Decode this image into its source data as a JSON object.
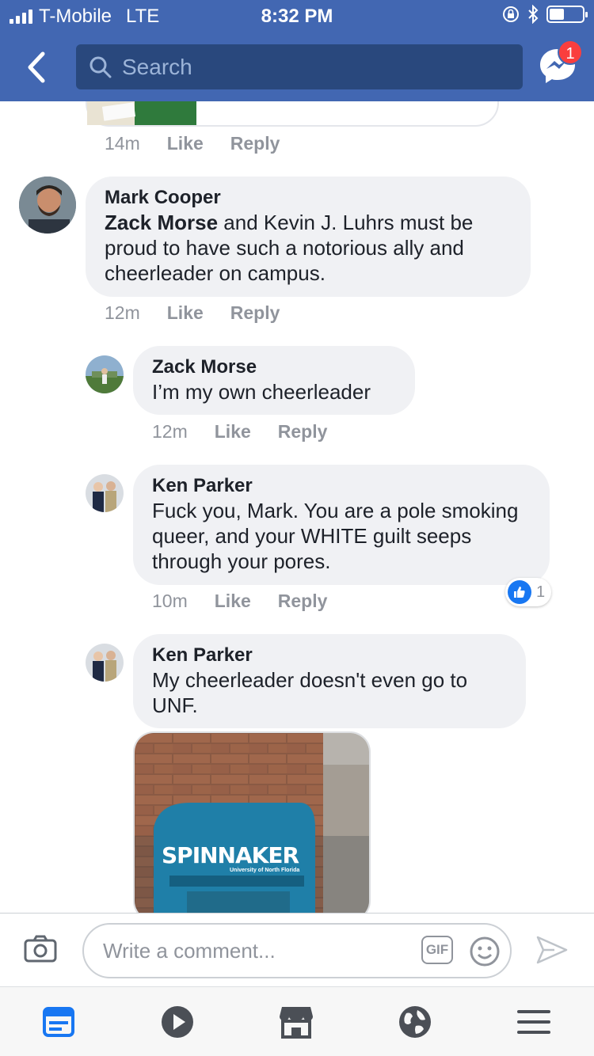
{
  "status_bar": {
    "carrier": "T-Mobile",
    "network": "LTE",
    "time": "8:32 PM"
  },
  "header": {
    "search_placeholder": "Search",
    "messenger_badge": "1"
  },
  "comments": [
    {
      "time": "14m",
      "like": "Like",
      "reply": "Reply"
    },
    {
      "name": "Mark Cooper",
      "mention": "Zack Morse",
      "text_after_mention": " and Kevin J. Luhrs must be proud to have such a notorious ally and cheerleader on campus.",
      "time": "12m",
      "like": "Like",
      "reply": "Reply"
    },
    {
      "name": "Zack Morse",
      "text": "I’m my own cheerleader",
      "time": "12m",
      "like": "Like",
      "reply": "Reply"
    },
    {
      "name": "Ken Parker",
      "text": "Fuck you, Mark. You are a pole smoking queer, and your WHITE guilt seeps through your pores.",
      "time": "10m",
      "like": "Like",
      "reply": "Reply",
      "reaction_count": "1"
    },
    {
      "name": "Ken Parker",
      "text": "My cheerleader doesn't even go to UNF.",
      "photo_sign": "SPINNAKER",
      "photo_subtitle": "University of North Florida"
    }
  ],
  "composer": {
    "placeholder": "Write a comment...",
    "gif_label": "GIF"
  }
}
